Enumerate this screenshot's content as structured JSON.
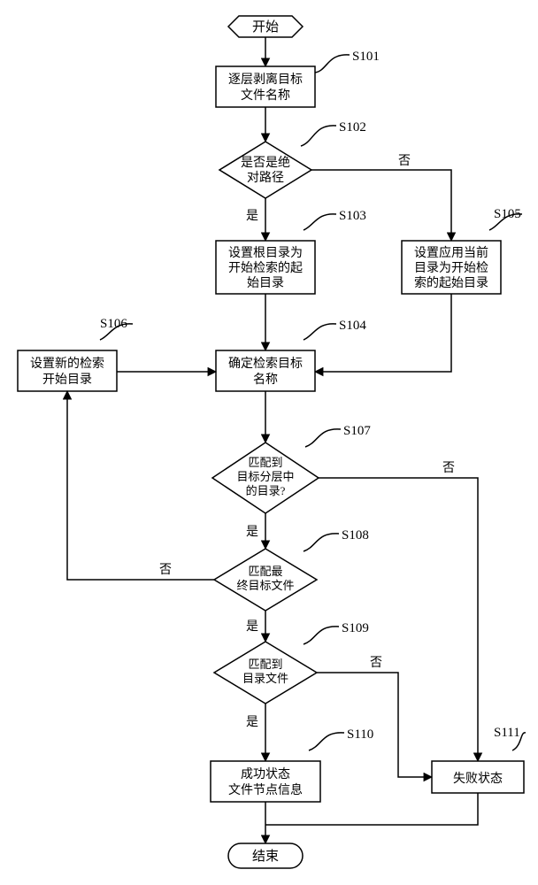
{
  "chart_data": {
    "type": "flowchart",
    "nodes": [
      {
        "id": "start",
        "shape": "terminator-hex",
        "text": "开始"
      },
      {
        "id": "s101",
        "shape": "process",
        "label": "S101",
        "text": [
          "逐层剥离目标",
          "文件名称"
        ]
      },
      {
        "id": "s102",
        "shape": "decision",
        "label": "S102",
        "text": [
          "是否是绝",
          "对路径"
        ]
      },
      {
        "id": "s103",
        "shape": "process",
        "label": "S103",
        "text": [
          "设置根目录为",
          "开始检索的起",
          "始目录"
        ]
      },
      {
        "id": "s104",
        "shape": "process",
        "label": "S104",
        "text": [
          "确定检索目标",
          "名称"
        ]
      },
      {
        "id": "s105",
        "shape": "process",
        "label": "S105",
        "text": [
          "设置应用当前",
          "目录为开始检",
          "索的起始目录"
        ]
      },
      {
        "id": "s106",
        "shape": "process",
        "label": "S106",
        "text": [
          "设置新的检索",
          "开始目录"
        ]
      },
      {
        "id": "s107",
        "shape": "decision",
        "label": "S107",
        "text": [
          "匹配到",
          "目标分层中",
          "的目录?"
        ]
      },
      {
        "id": "s108",
        "shape": "decision",
        "label": "S108",
        "text": [
          "匹配最",
          "终目标文件"
        ]
      },
      {
        "id": "s109",
        "shape": "decision",
        "label": "S109",
        "text": [
          "匹配到",
          "目录文件"
        ]
      },
      {
        "id": "s110",
        "shape": "process",
        "label": "S110",
        "text": [
          "成功状态",
          "文件节点信息"
        ]
      },
      {
        "id": "s111",
        "shape": "process",
        "label": "S111",
        "text": [
          "失败状态"
        ]
      },
      {
        "id": "end",
        "shape": "terminator-round",
        "text": "结束"
      }
    ],
    "edges": [
      {
        "from": "start",
        "to": "s101"
      },
      {
        "from": "s101",
        "to": "s102"
      },
      {
        "from": "s102",
        "to": "s103",
        "label": "是"
      },
      {
        "from": "s102",
        "to": "s105",
        "label": "否"
      },
      {
        "from": "s103",
        "to": "s104"
      },
      {
        "from": "s105",
        "to": "s104"
      },
      {
        "from": "s104",
        "to": "s107"
      },
      {
        "from": "s107",
        "to": "s108",
        "label": "是"
      },
      {
        "from": "s107",
        "to": "s111",
        "label": "否"
      },
      {
        "from": "s108",
        "to": "s109",
        "label": "是"
      },
      {
        "from": "s108",
        "to": "s106",
        "label": "否"
      },
      {
        "from": "s106",
        "to": "s104"
      },
      {
        "from": "s109",
        "to": "s110",
        "label": "是"
      },
      {
        "from": "s109",
        "to": "s111",
        "label": "否"
      },
      {
        "from": "s110",
        "to": "end"
      },
      {
        "from": "s111",
        "to": "end"
      }
    ],
    "branch_labels": {
      "yes": "是",
      "no": "否"
    }
  }
}
